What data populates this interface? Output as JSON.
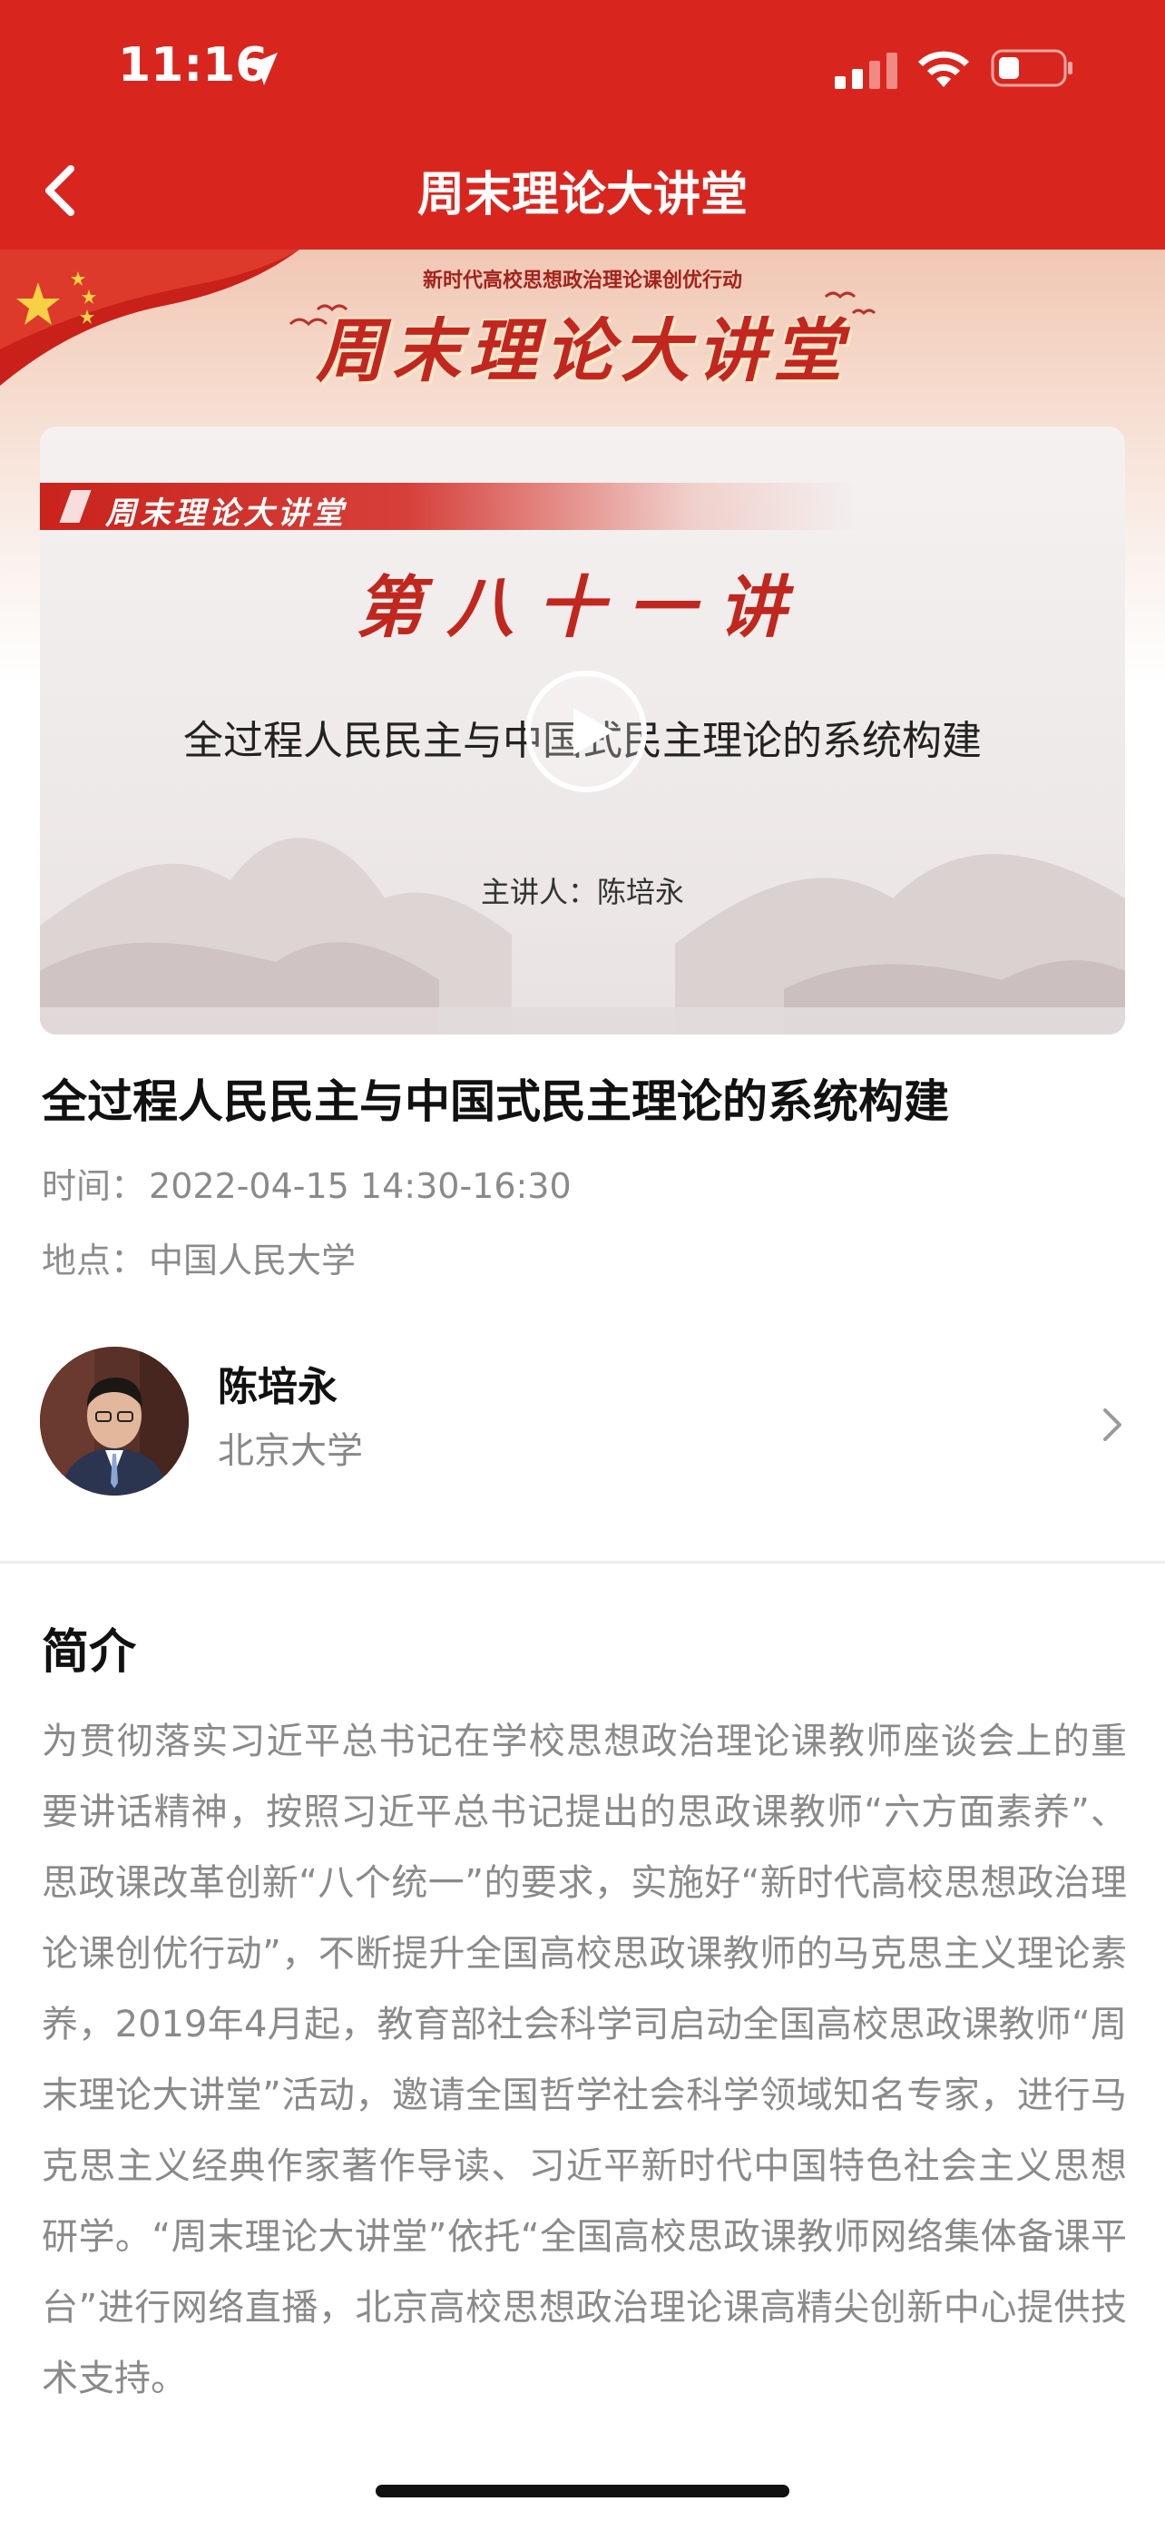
{
  "status_bar": {
    "time": "11:16"
  },
  "nav": {
    "title": "周末理论大讲堂"
  },
  "banner": {
    "subtitle": "新时代高校思想政治理论课创优行动",
    "title": "周末理论大讲堂"
  },
  "video": {
    "tag": "周末理论大讲堂",
    "lecture_no": "第八十一讲",
    "topic": "全过程人民民主与中国式民主理论的系统构建",
    "speaker": "主讲人：陈培永"
  },
  "article": {
    "title": "全过程人民民主与中国式民主理论的系统构建",
    "time_label": "时间：",
    "time_value": "2022-04-15 14:30-16:30",
    "place_label": "地点：",
    "place_value": "中国人民大学"
  },
  "speaker": {
    "name": "陈培永",
    "org": "北京大学"
  },
  "intro": {
    "heading": "简介",
    "body": "为贯彻落实习近平总书记在学校思想政治理论课教师座谈会上的重要讲话精神，按照习近平总书记提出的思政课教师“六方面素养”、思政课改革创新“八个统一”的要求，实施好“新时代高校思想政治理论课创优行动”，不断提升全国高校思政课教师的马克思主义理论素养，2019年4月起，教育部社会科学司启动全国高校思政课教师“周末理论大讲堂”活动，邀请全国哲学社会科学领域知名专家，进行马克思主义经典作家著作导读、习近平新时代中国特色社会主义思想研学。“周末理论大讲堂”依托“全国高校思政课教师网络集体备课平台”进行网络直播，北京高校思想政治理论课高精尖创新中心提供技术支持。"
  },
  "colors": {
    "brand_red": "#d8261f",
    "text_dark": "#111111",
    "text_gray": "#8a8a8a"
  }
}
